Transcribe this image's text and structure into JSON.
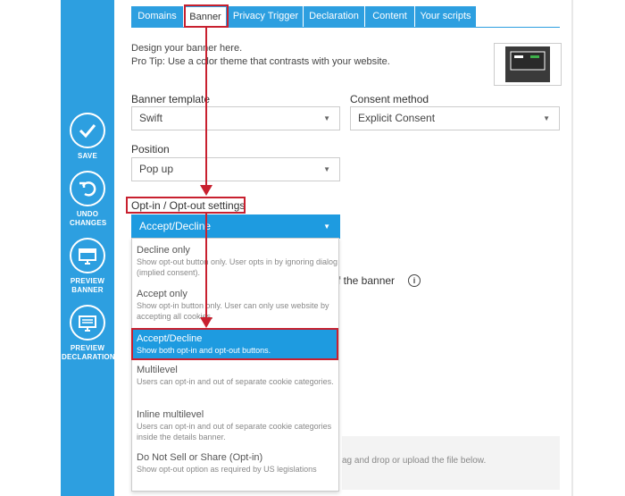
{
  "sidebar": {
    "items": [
      {
        "label": "SAVE",
        "icon": "checkmark-icon"
      },
      {
        "label": "UNDO CHANGES",
        "icon": "undo-icon"
      },
      {
        "label": "PREVIEW BANNER",
        "icon": "monitor-icon"
      },
      {
        "label": "PREVIEW DECLARATION",
        "icon": "monitor-icon"
      }
    ]
  },
  "tabs": [
    "Domains",
    "Banner",
    "Privacy Trigger",
    "Declaration",
    "Content",
    "Your scripts"
  ],
  "active_tab": "Banner",
  "intro": {
    "line1": "Design your banner here.",
    "line2": "Pro Tip: Use a color theme that contrasts with your website."
  },
  "fields": {
    "banner_template": {
      "label": "Banner template",
      "value": "Swift"
    },
    "consent_method": {
      "label": "Consent method",
      "value": "Explicit Consent"
    },
    "position": {
      "label": "Position",
      "value": "Pop up"
    },
    "optin": {
      "label": "Opt-in / Opt-out settings",
      "value": "Accept/Decline"
    }
  },
  "dropdown_options": [
    {
      "title": "Decline only",
      "desc": "Show opt-out button only. User opts in by ignoring dialog (implied consent)."
    },
    {
      "title": "Accept only",
      "desc": "Show opt-in button only. User can only use website by accepting all cookies."
    },
    {
      "title": "Accept/Decline",
      "desc": "Show both opt-in and opt-out buttons.",
      "selected": true
    },
    {
      "title": "Multilevel",
      "desc": "Users can opt-in and out of separate cookie categories."
    },
    {
      "title": "Inline multilevel",
      "desc": "Users can opt-in and out of separate cookie categories inside the details banner."
    },
    {
      "title": "Do Not Sell or Share (Opt-in)",
      "desc": "Show opt-out option as required by US legislations"
    }
  ],
  "behind": {
    "banner_text": "f the banner",
    "info": "i",
    "drop_text": "ag and drop or upload the file below."
  },
  "colors": {
    "accent": "#2d9fe0",
    "highlight": "#c8202f"
  }
}
